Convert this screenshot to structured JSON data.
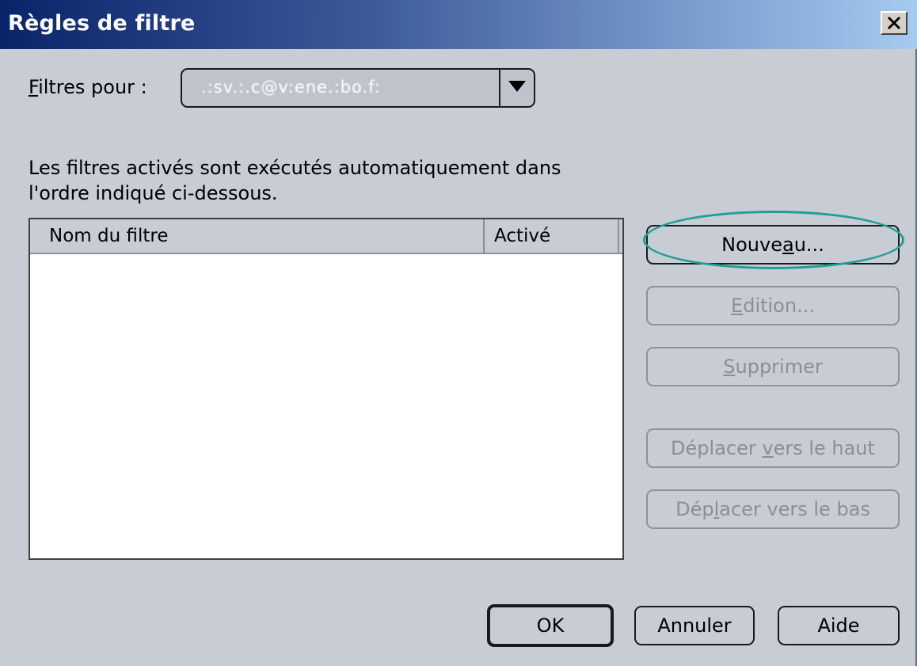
{
  "window": {
    "title": "Règles de filtre",
    "close_label": "X"
  },
  "filters_for": {
    "label_first": "F",
    "label_rest": "iltres pour :",
    "selected_value": ".:sv.:.c@v:ene.:bo.f:"
  },
  "description": {
    "line1": "Les filtres activés sont exécutés automatiquement dans",
    "line2": "l'ordre indiqué ci-dessous."
  },
  "list": {
    "columns": [
      "Nom du filtre",
      "Activé"
    ],
    "rows": []
  },
  "side_buttons": {
    "new": {
      "before": "Nouve",
      "accel": "a",
      "after": "u..."
    },
    "edit": {
      "before": "",
      "accel": "E",
      "after": "dition..."
    },
    "delete": {
      "before": "",
      "accel": "S",
      "after": "upprimer"
    },
    "move_up": {
      "before": "Déplacer ",
      "accel": "v",
      "after": "ers le haut"
    },
    "move_down": {
      "before": "Dép",
      "accel": "l",
      "after": "acer vers le bas"
    }
  },
  "footer_buttons": {
    "ok": "OK",
    "cancel": "Annuler",
    "help": "Aide"
  },
  "colors": {
    "dialog_bg": "#c8ccd4",
    "title_start": "#0a246a",
    "title_end": "#a6caf0",
    "highlight": "#1f9e96"
  }
}
